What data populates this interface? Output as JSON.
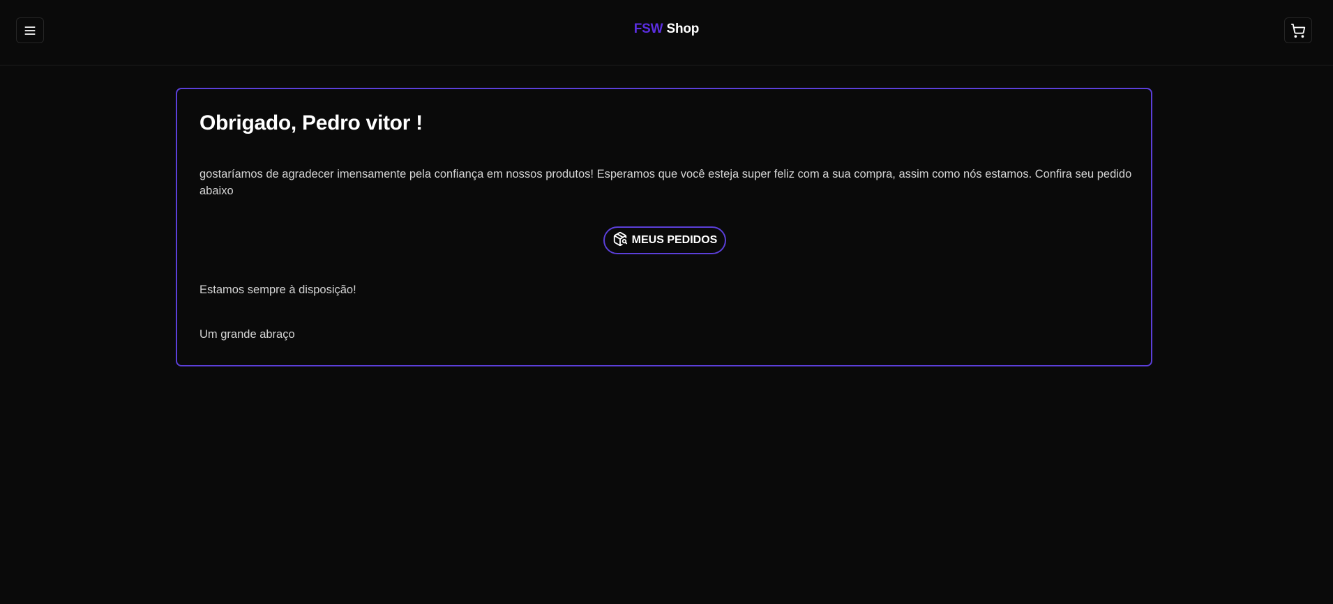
{
  "header": {
    "logo_brand": "FSW",
    "logo_rest": "Shop",
    "menu_icon": "menu-icon",
    "cart_icon": "shopping-cart-icon"
  },
  "card": {
    "title": "Obrigado, Pedro vitor !",
    "message": "gostaríamos de agradecer imensamente pela confiança em nossos produtos! Esperamos que você esteja super feliz com a sua compra, assim como nós estamos. Confira seu pedido abaixo",
    "button_label": "MEUS PEDIDOS",
    "button_icon": "package-search-icon",
    "availability_text": "Estamos sempre à disposição!",
    "closing_text": "Um grande abraço"
  },
  "colors": {
    "background": "#0a0a0a",
    "accent": "#5b3fd9",
    "brand": "#5b2ee0",
    "text": "#ffffff",
    "muted_text": "#d4d4d4"
  }
}
